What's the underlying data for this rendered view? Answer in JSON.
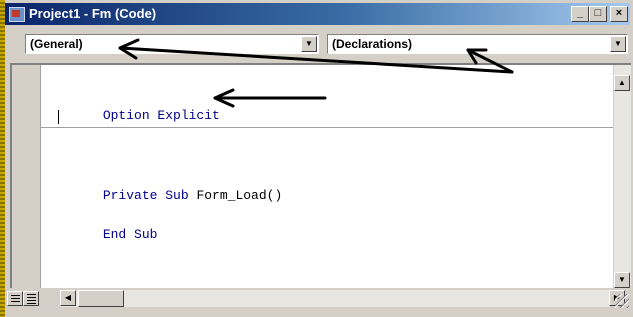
{
  "window": {
    "title": "Project1 - Fm (Code)",
    "controls": {
      "minimize": "_",
      "maximize": "□",
      "close": "×"
    }
  },
  "object_combo": {
    "selected": "(General)"
  },
  "procedure_combo": {
    "selected": "(Declarations)"
  },
  "code": {
    "lines": [
      {
        "keyword": "Option Explicit",
        "rest": ""
      },
      {
        "keyword": "Private Sub",
        "rest": " Form_Load()"
      },
      {
        "keyword": "End Sub",
        "rest": ""
      }
    ]
  },
  "icons": {
    "app": "vb-project-icon",
    "dropdown": "chevron-down-icon",
    "procedure_view": "procedure-view-icon",
    "full_module_view": "full-module-view-icon"
  },
  "colors": {
    "titlebar_start": "#0a246a",
    "titlebar_end": "#a6caf0",
    "keyword": "#00008b",
    "window_face": "#d4d0c8"
  }
}
